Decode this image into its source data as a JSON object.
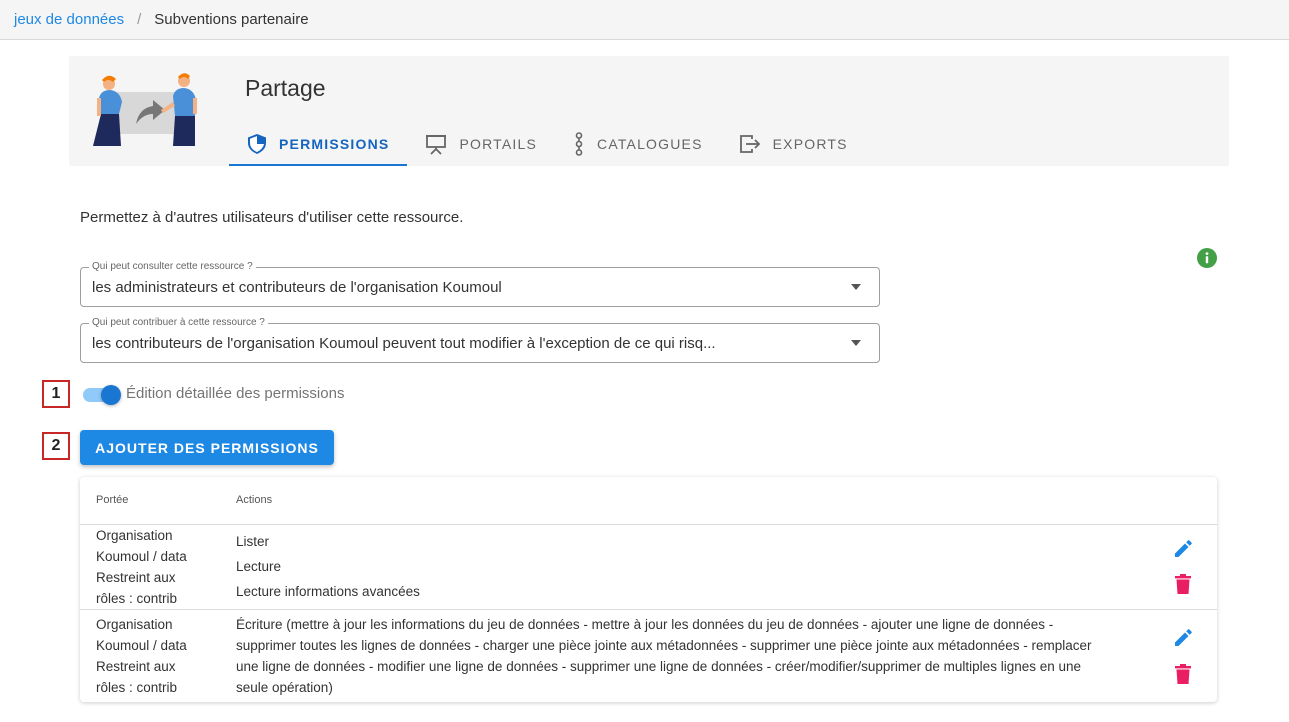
{
  "breadcrumb": {
    "link": "jeux de données",
    "separator": "/",
    "current": "Subventions partenaire"
  },
  "header": {
    "title": "Partage",
    "tabs": [
      {
        "label": "Permissions",
        "icon": "shield-icon",
        "active": true
      },
      {
        "label": "Portails",
        "icon": "presentation-icon",
        "active": false
      },
      {
        "label": "Catalogues",
        "icon": "nodes-icon",
        "active": false
      },
      {
        "label": "Exports",
        "icon": "export-icon",
        "active": false
      }
    ]
  },
  "intro_text": "Permettez à d'autres utilisateurs d'utiliser cette ressource.",
  "read_select": {
    "label": "Qui peut consulter cette ressource ?",
    "value": "les administrateurs et contributeurs de l'organisation Koumoul"
  },
  "write_select": {
    "label": "Qui peut contribuer à cette ressource ?",
    "value": "les contributeurs de l'organisation Koumoul peuvent tout modifier à l'exception de ce qui risq..."
  },
  "markers": [
    "1",
    "2"
  ],
  "toggle": {
    "label": "Édition détaillée des permissions",
    "on": true
  },
  "add_button": "Ajouter des permissions",
  "table": {
    "headers": [
      "Portée",
      "Actions"
    ],
    "rows": [
      {
        "scope": [
          "Organisation",
          "Koumoul / data",
          "Restreint aux",
          "rôles : contrib"
        ],
        "actions": [
          "Lister",
          "Lecture",
          "Lecture informations avancées"
        ]
      },
      {
        "scope": [
          "Organisation",
          "Koumoul / data",
          "Restreint aux",
          "rôles : contrib"
        ],
        "actions": [
          "Écriture (mettre à jour les informations du jeu de données - mettre à jour les données du jeu de données - ajouter une ligne de données - supprimer toutes les lignes de données - charger une pièce jointe aux métadonnées - supprimer une pièce jointe aux métadonnées - remplacer une ligne de données - modifier une ligne de données - supprimer une ligne de données - créer/modifier/supprimer de multiples lignes en une seule opération)"
        ]
      }
    ]
  },
  "colors": {
    "primary": "#1e88e5",
    "delete": "#e91e63",
    "info": "#43a047",
    "marker_border": "#c62828"
  }
}
